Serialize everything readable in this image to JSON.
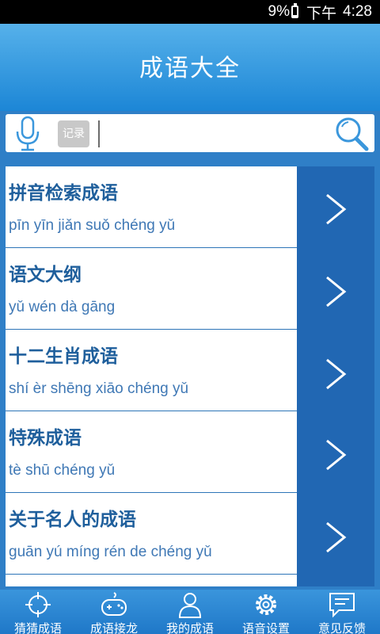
{
  "status_bar": {
    "battery": "9%",
    "time_prefix": "下午",
    "time": "4:28"
  },
  "header": {
    "title": "成语大全"
  },
  "search": {
    "record_label": "记录",
    "value": "",
    "placeholder": "",
    "mic_icon": "microphone-icon",
    "search_icon": "magnifier-icon"
  },
  "list": {
    "items": [
      {
        "title": "拼音检索成语",
        "pinyin": "pīn yīn jiǎn suǒ chéng yǔ"
      },
      {
        "title": "语文大纲",
        "pinyin": "yǔ wén dà gāng"
      },
      {
        "title": "十二生肖成语",
        "pinyin": "shí èr shēng xiāo chéng yǔ"
      },
      {
        "title": "特殊成语",
        "pinyin": "tè shū chéng yǔ"
      },
      {
        "title": "关于名人的成语",
        "pinyin": "guān yú míng rén de chéng yǔ"
      }
    ]
  },
  "bottom_nav": {
    "items": [
      {
        "label": "猜猜成语",
        "icon": "crosshair-icon"
      },
      {
        "label": "成语接龙",
        "icon": "gamepad-icon"
      },
      {
        "label": "我的成语",
        "icon": "user-icon"
      },
      {
        "label": "语音设置",
        "icon": "gear-icon"
      },
      {
        "label": "意见反馈",
        "icon": "feedback-icon"
      }
    ]
  },
  "colors": {
    "header_top": "#56b1ea",
    "header_bottom": "#1c86d6",
    "arrow_column": "#2167b3",
    "title_text": "#1f5f9c",
    "pinyin_text": "#3f78b5"
  }
}
